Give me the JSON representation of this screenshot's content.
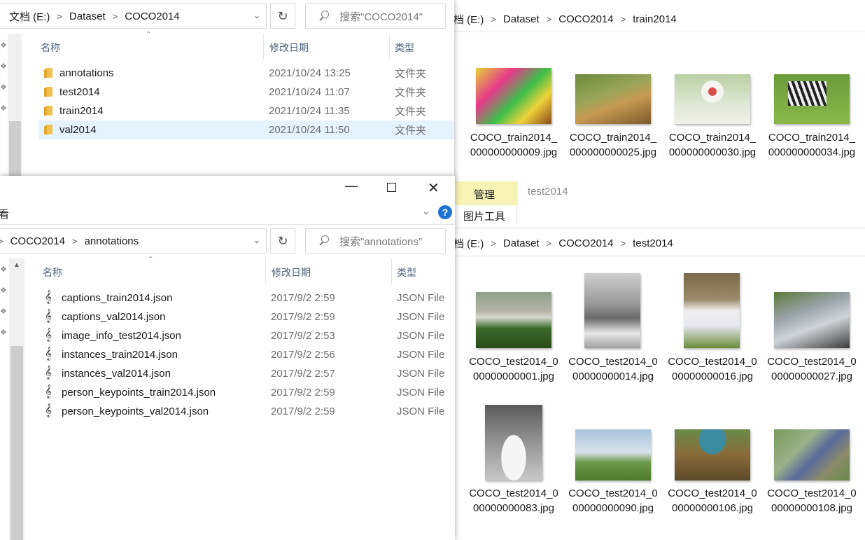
{
  "top_left_window": {
    "breadcrumb": [
      "文档 (E:)",
      "Dataset",
      "COCO2014"
    ],
    "search_placeholder": "搜索\"COCO2014\"",
    "columns": {
      "name": "名称",
      "date": "修改日期",
      "type": "类型"
    },
    "rows": [
      {
        "name": "annotations",
        "date": "2021/10/24 13:25",
        "type": "文件夹"
      },
      {
        "name": "test2014",
        "date": "2021/10/24 11:07",
        "type": "文件夹"
      },
      {
        "name": "train2014",
        "date": "2021/10/24 11:35",
        "type": "文件夹"
      },
      {
        "name": "val2014",
        "date": "2021/10/24 11:50",
        "type": "文件夹"
      }
    ]
  },
  "top_right_window": {
    "breadcrumb": [
      "档 (E:)",
      "Dataset",
      "COCO2014",
      "train2014"
    ],
    "files": [
      {
        "caption": "COCO_train2014_000000000009.jpg"
      },
      {
        "caption": "COCO_train2014_000000000025.jpg"
      },
      {
        "caption": "COCO_train2014_000000000030.jpg"
      },
      {
        "caption": "COCO_train2014_000000000034.jpg"
      }
    ]
  },
  "ribbon": {
    "manage_tab": "管理",
    "folder_title": "test2014",
    "picture_tools": "图片工具"
  },
  "bottom_right_window": {
    "breadcrumb": [
      "档 (E:)",
      "Dataset",
      "COCO2014",
      "test2014"
    ],
    "files": [
      {
        "caption": "COCO_test2014_000000000001.jpg"
      },
      {
        "caption": "COCO_test2014_000000000014.jpg"
      },
      {
        "caption": "COCO_test2014_000000000016.jpg"
      },
      {
        "caption": "COCO_test2014_000000000027.jpg"
      },
      {
        "caption": "COCO_test2014_000000000083.jpg"
      },
      {
        "caption": "COCO_test2014_000000000090.jpg"
      },
      {
        "caption": "COCO_test2014_000000000106.jpg"
      },
      {
        "caption": "COCO_test2014_000000000108.jpg"
      }
    ]
  },
  "bottom_left_window": {
    "view_label": "看",
    "breadcrumb": [
      "COCO2014",
      "annotations"
    ],
    "search_placeholder": "搜索\"annotations\"",
    "columns": {
      "name": "名称",
      "date": "修改日期",
      "type": "类型"
    },
    "rows": [
      {
        "name": "captions_train2014.json",
        "date": "2017/9/2 2:59",
        "type": "JSON File"
      },
      {
        "name": "captions_val2014.json",
        "date": "2017/9/2 2:59",
        "type": "JSON File"
      },
      {
        "name": "image_info_test2014.json",
        "date": "2017/9/2 2:53",
        "type": "JSON File"
      },
      {
        "name": "instances_train2014.json",
        "date": "2017/9/2 2:56",
        "type": "JSON File"
      },
      {
        "name": "instances_val2014.json",
        "date": "2017/9/2 2:57",
        "type": "JSON File"
      },
      {
        "name": "person_keypoints_train2014.json",
        "date": "2017/9/2 2:59",
        "type": "JSON File"
      },
      {
        "name": "person_keypoints_val2014.json",
        "date": "2017/9/2 2:59",
        "type": "JSON File"
      }
    ]
  },
  "colors": {
    "selection": "#e5f3ff",
    "ribbon_manage": "#f7f3b4",
    "help": "#1a73d1"
  }
}
